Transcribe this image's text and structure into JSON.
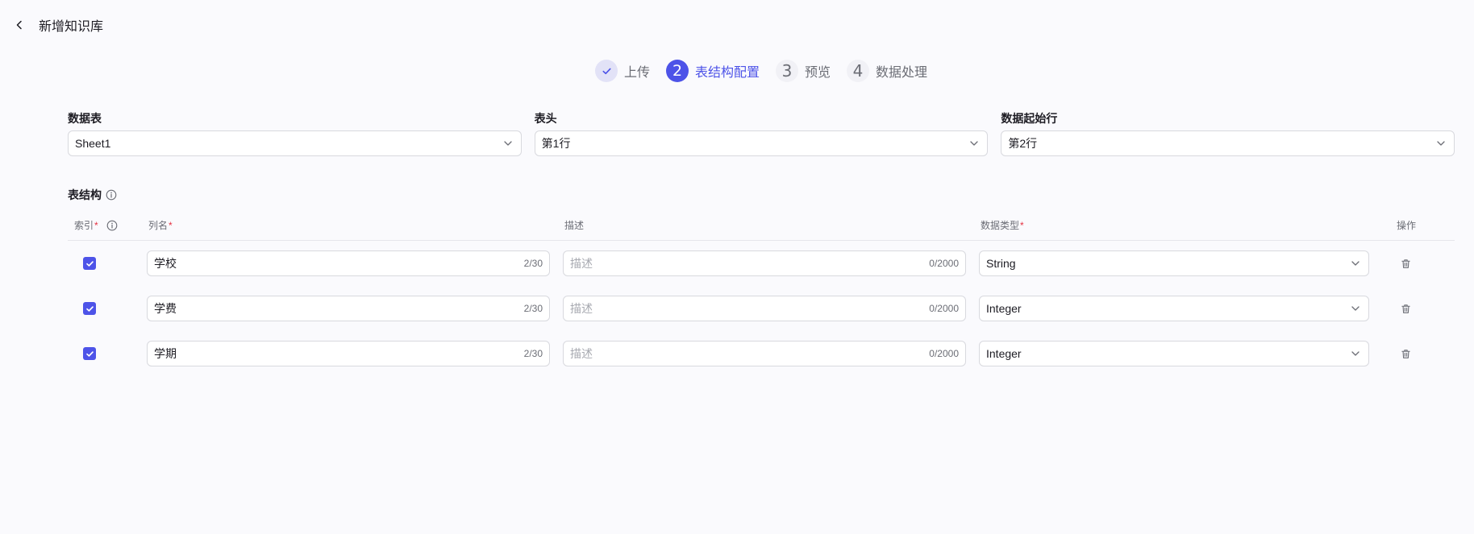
{
  "header": {
    "title": "新增知识库",
    "back_icon": "chevron-left-icon"
  },
  "steps": [
    {
      "number": "",
      "label": "上传",
      "state": "done"
    },
    {
      "number": "2",
      "label": "表结构配置",
      "state": "active"
    },
    {
      "number": "3",
      "label": "预览",
      "state": "pending"
    },
    {
      "number": "4",
      "label": "数据处理",
      "state": "pending"
    }
  ],
  "config": {
    "sheet": {
      "label": "数据表",
      "value": "Sheet1"
    },
    "header_row": {
      "label": "表头",
      "value": "第1行"
    },
    "start_row": {
      "label": "数据起始行",
      "value": "第2行"
    }
  },
  "table": {
    "title": "表结构",
    "columns": {
      "index": "索引",
      "name": "列名",
      "description": "描述",
      "type": "数据类型",
      "actions": "操作"
    },
    "required_mark": "*",
    "rows": [
      {
        "checked": true,
        "name": "学校",
        "name_count": "2/30",
        "desc_placeholder": "描述",
        "desc_count": "0/2000",
        "type": "String"
      },
      {
        "checked": true,
        "name": "学费",
        "name_count": "2/30",
        "desc_placeholder": "描述",
        "desc_count": "0/2000",
        "type": "Integer"
      },
      {
        "checked": true,
        "name": "学期",
        "name_count": "2/30",
        "desc_placeholder": "描述",
        "desc_count": "0/2000",
        "type": "Integer"
      }
    ]
  },
  "colors": {
    "accent": "#4d53e8",
    "required": "#e53242",
    "muted": "#6b6d75",
    "background": "#fafafd"
  }
}
